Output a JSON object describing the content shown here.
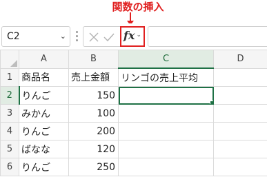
{
  "annotation": {
    "label": "関数の挿入"
  },
  "formula_bar": {
    "name_box": "C2",
    "fx_label": "fx",
    "formula": ""
  },
  "sheet": {
    "columns": [
      "A",
      "B",
      "C",
      "D"
    ],
    "rows": [
      {
        "num": "1",
        "a": "商品名",
        "b": "売上金額",
        "c": "リンゴの売上平均",
        "d": ""
      },
      {
        "num": "2",
        "a": "りんご",
        "b": "150",
        "c": "",
        "d": ""
      },
      {
        "num": "3",
        "a": "みかん",
        "b": "100",
        "c": "",
        "d": ""
      },
      {
        "num": "4",
        "a": "りんご",
        "b": "200",
        "c": "",
        "d": ""
      },
      {
        "num": "5",
        "a": "ばなな",
        "b": "120",
        "c": "",
        "d": ""
      },
      {
        "num": "6",
        "a": "りんご",
        "b": "250",
        "c": "",
        "d": ""
      }
    ],
    "active_cell": "C2"
  },
  "colors": {
    "accent": "#1e7145",
    "callout": "#e02020"
  }
}
